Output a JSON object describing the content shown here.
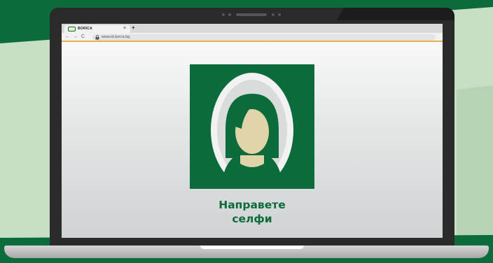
{
  "browser": {
    "tab_title": "BORICA",
    "tab_close": "×",
    "new_tab": "+",
    "nav_back": "←",
    "nav_forward": "→",
    "nav_reload": "C",
    "url": "www.id.borca.bg"
  },
  "main": {
    "cta_line1": "Направете",
    "cta_line2": "селфи"
  },
  "colors": {
    "brand_green": "#0c6b3a",
    "light_green": "#c7dfc4",
    "skin": "#e0d4a8",
    "accent_yellow": "#e3b24a"
  },
  "icons": {
    "favicon": "borica-logo-icon",
    "lock": "lock-icon",
    "avatar": "selfie-portrait-icon"
  }
}
